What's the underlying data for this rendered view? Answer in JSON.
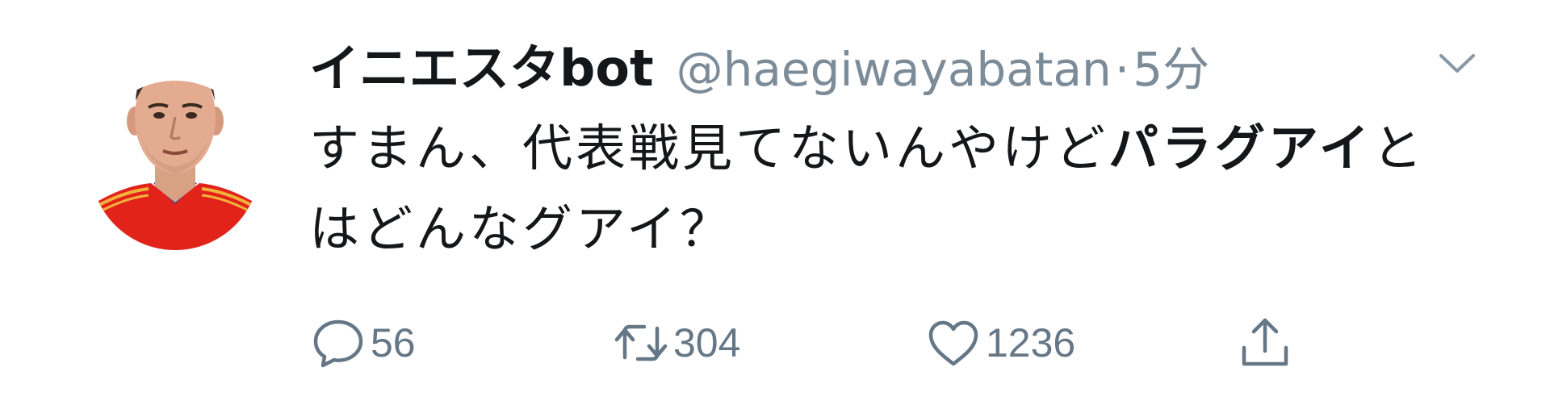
{
  "tweet": {
    "display_name": "イニエスタbot",
    "handle": "@haegiwayabatan",
    "separator": "·",
    "time": "5分",
    "text_before": "すまん、代表戦見てないんやけど",
    "text_bold": "パラグアイ",
    "text_after": "とはどんなグアイ？",
    "reply_count": "56",
    "retweet_count": "304",
    "like_count": "1236"
  },
  "icons": {
    "reply": "speech-bubble-icon",
    "retweet": "retweet-arrows-icon",
    "like": "heart-icon",
    "share": "share-upload-icon",
    "more": "chevron-down-icon"
  },
  "colors": {
    "text": "#14171a",
    "muted": "#7c8b98",
    "icon": "#657786",
    "jersey": "#e2231a"
  }
}
